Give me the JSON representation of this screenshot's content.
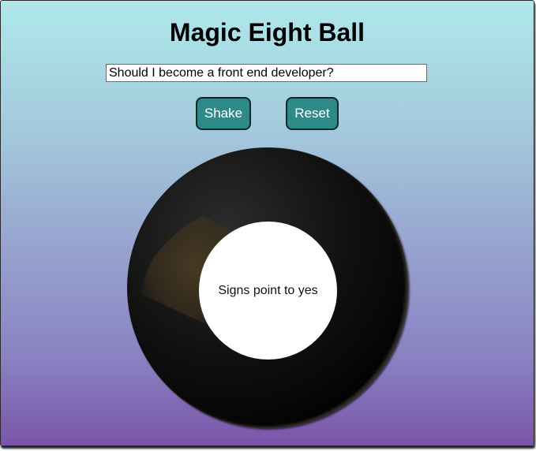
{
  "page": {
    "title": "Magic Eight Ball"
  },
  "question": {
    "value": "Should I become a front end developer?"
  },
  "controls": {
    "shake_label": "Shake",
    "reset_label": "Reset"
  },
  "ball": {
    "answer": "Signs point to yes"
  },
  "colors": {
    "background_top": "#aee9ea",
    "background_bottom": "#7a55a9",
    "button": "#2e8a88",
    "ball": "#0a0a0a",
    "answer_window": "#ffffff"
  }
}
